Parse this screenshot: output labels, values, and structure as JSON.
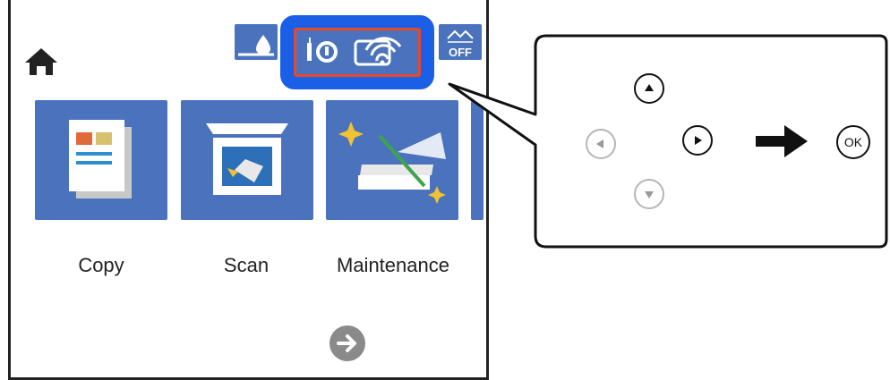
{
  "tiles": [
    {
      "label": "Copy"
    },
    {
      "label": "Scan"
    },
    {
      "label": "Maintenance"
    }
  ],
  "icons": {
    "home": "home-icon",
    "ink": "ink-icon",
    "wired_lan": "wired-lan-icon",
    "wifi": "wifi-icon",
    "wifi_direct_off": "wifi-direct-off-icon",
    "next": "arrow-right-icon"
  },
  "status_icons": {
    "wifi_direct_label": "OFF"
  },
  "control_panel": {
    "ok_label": "OK",
    "buttons": [
      "up",
      "left",
      "right",
      "down",
      "ok"
    ]
  },
  "colors": {
    "tile_blue": "#4b73bd",
    "highlight_blue": "#1a5fe6",
    "highlight_red": "#e8472a"
  }
}
